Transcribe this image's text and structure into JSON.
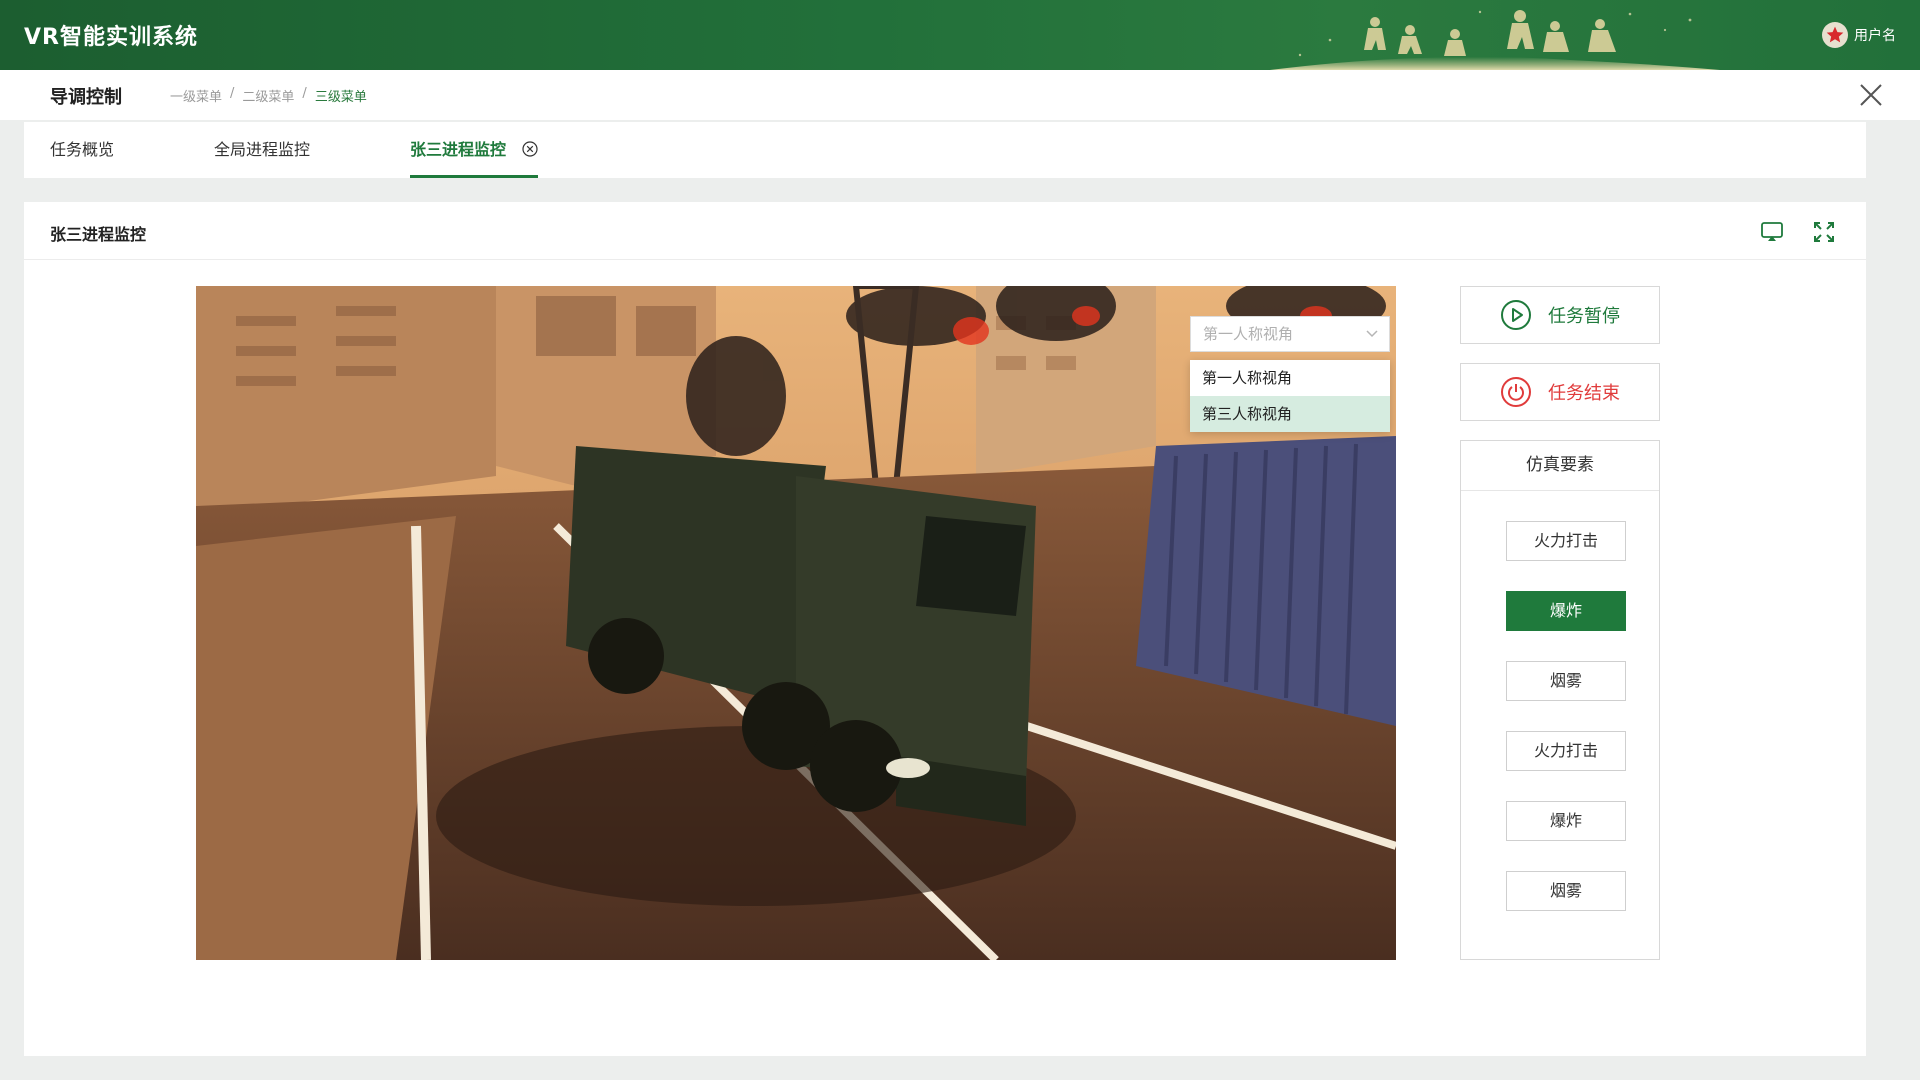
{
  "header": {
    "app_title": "VR智能实训系统",
    "username": "用户名",
    "star_icon": "red-star-icon"
  },
  "crumbs": {
    "page_title": "导调控制",
    "items": [
      "一级菜单",
      "二级菜单",
      "三级菜单"
    ],
    "separator": "/"
  },
  "tabs": [
    {
      "label": "任务概览"
    },
    {
      "label": "全局进程监控"
    },
    {
      "label": "张三进程监控",
      "active": true
    }
  ],
  "panel": {
    "title": "张三进程监控"
  },
  "view": {
    "placeholder": "第一人称视角",
    "options": [
      "第一人称视角",
      "第三人称视角"
    ],
    "highlighted": "第三人称视角"
  },
  "controls": {
    "pause_label": "任务暂停",
    "stop_label": "任务结束",
    "elements_title": "仿真要素",
    "elements": [
      {
        "label": "火力打击"
      },
      {
        "label": "爆炸",
        "active": true
      },
      {
        "label": "烟雾"
      },
      {
        "label": "火力打击"
      },
      {
        "label": "爆炸"
      },
      {
        "label": "烟雾"
      }
    ]
  },
  "colors": {
    "brand_green": "#1f7a3c",
    "danger_red": "#e03b3b",
    "highlight": "#d6ece0"
  }
}
